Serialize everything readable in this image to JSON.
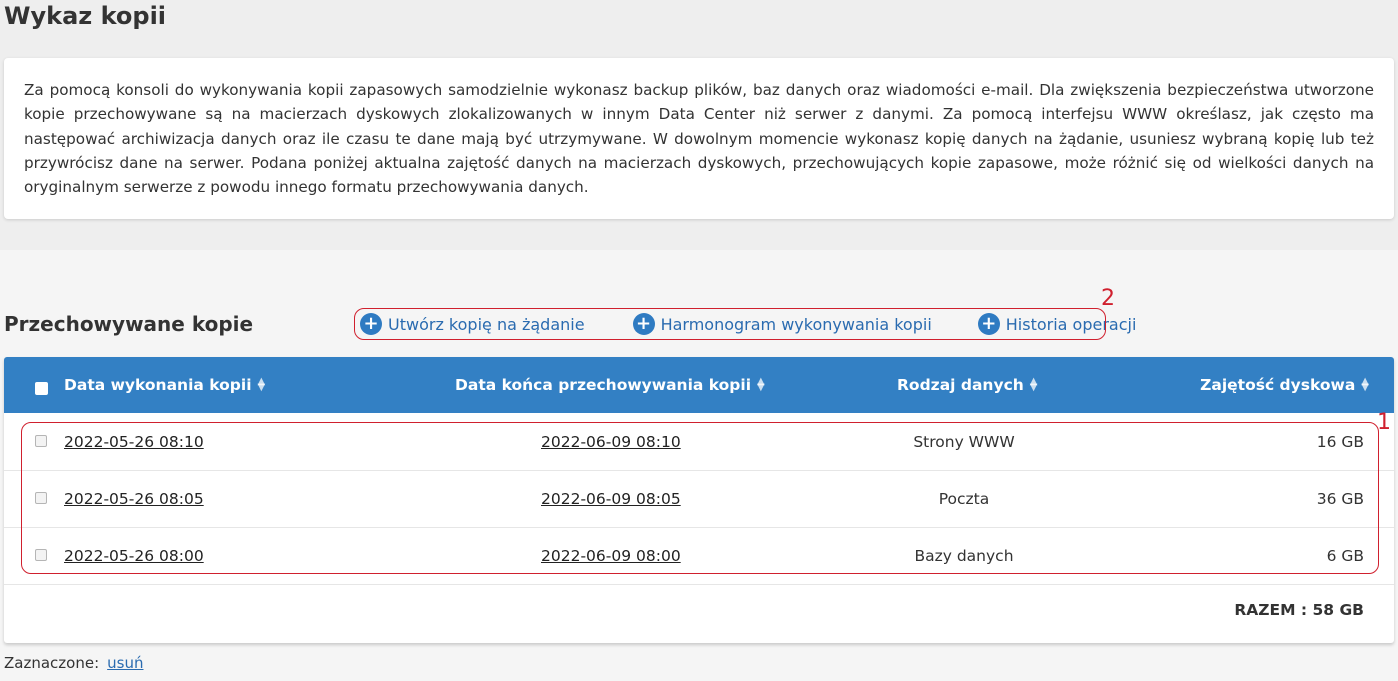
{
  "page": {
    "title": "Wykaz kopii",
    "description": "Za pomocą konsoli do wykonywania kopii zapasowych samodzielnie wykonasz backup plików, baz danych oraz wiadomości e-mail. Dla zwiększenia bezpieczeństwa utworzone kopie przechowywane są na macierzach dyskowych zlokalizowanych w innym Data Center niż serwer z danymi. Za pomocą interfejsu WWW określasz, jak często ma następować archiwizacja danych oraz ile czasu te dane mają być utrzymywane. W dowolnym momencie wykonasz kopię danych na żądanie, usuniesz wybraną kopię lub też przywrócisz dane na serwer. Podana poniżej aktualna zajętość danych na macierzach dyskowych, przechowujących kopie zapasowe, może różnić się od wielkości danych na oryginalnym serwerze z powodu innego formatu przechowywania danych."
  },
  "section": {
    "title": "Przechowywane kopie",
    "actions": [
      {
        "label": "Utwórz kopię na żądanie",
        "icon": "plus-circle-icon"
      },
      {
        "label": "Harmonogram wykonywania kopii",
        "icon": "plus-circle-icon"
      },
      {
        "label": "Historia operacji",
        "icon": "plus-circle-icon"
      }
    ]
  },
  "annotations": {
    "rows_marker": "1",
    "actions_marker": "2",
    "color": "#d0202e"
  },
  "table": {
    "columns": [
      "Data wykonania kopii",
      "Data końca przechowywania kopii",
      "Rodzaj danych",
      "Zajętość dyskowa"
    ],
    "rows": [
      {
        "created": "2022-05-26 08:10",
        "expires": "2022-06-09 08:10",
        "type": "Strony WWW",
        "size": "16 GB"
      },
      {
        "created": "2022-05-26 08:05",
        "expires": "2022-06-09 08:05",
        "type": "Poczta",
        "size": "36 GB"
      },
      {
        "created": "2022-05-26 08:00",
        "expires": "2022-06-09 08:00",
        "type": "Bazy danych",
        "size": "6 GB"
      }
    ],
    "total": "RAZEM : 58 GB",
    "header_color": "#3380c4"
  },
  "footer": {
    "selected_label": "Zaznaczone:",
    "delete_link": "usuń"
  }
}
